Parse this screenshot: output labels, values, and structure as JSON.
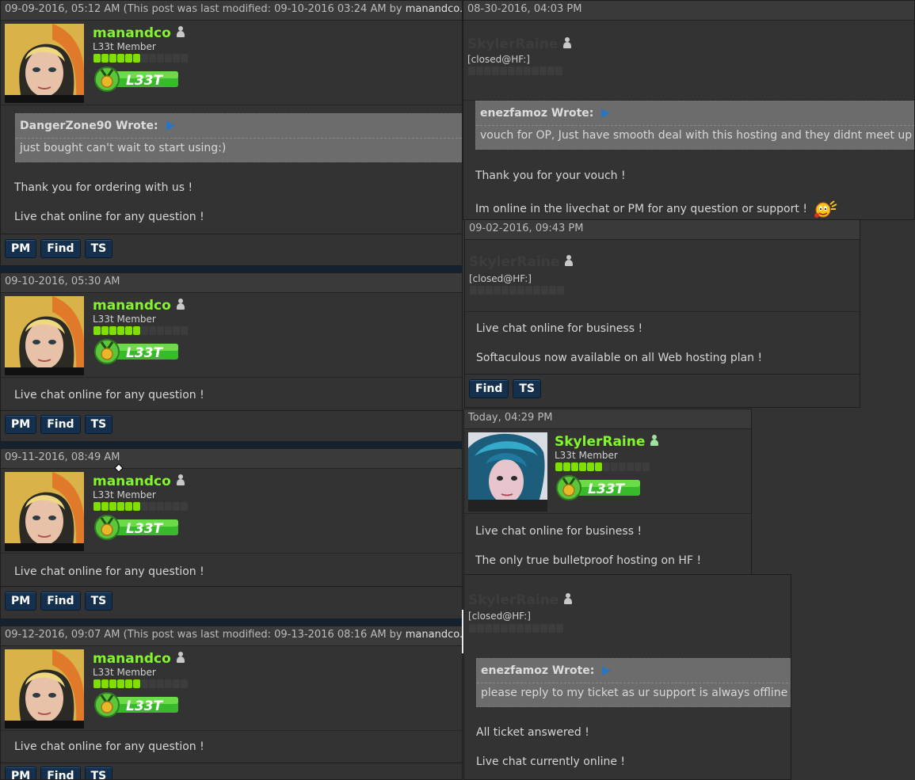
{
  "colors": {
    "username": "#83f52c",
    "ghost_username": "#3d3d3d",
    "button_bg": "#15304d",
    "quote_bg": "#6c6c6c",
    "reputation": "#7fe000"
  },
  "user": {
    "name": "manandco",
    "title": "L33t Member",
    "badge": "L33T"
  },
  "skyler": {
    "name": "SkylerRaine",
    "title": "L33t Member",
    "closed_title": "[closed@HF:]",
    "badge": "L33T"
  },
  "buttons": {
    "pm": "PM",
    "find": "Find",
    "ts": "TS"
  },
  "left_posts": [
    {
      "date": "09-09-2016, 05:12 AM",
      "modified_prefix": "(This post was last modified: 09-10-2016 03:24 AM by ",
      "modified_by": "manandco.",
      "quote_author": "DangerZone90 Wrote:",
      "quote_text": "just bought can't wait to start using:)",
      "line1": "Thank you for ordering with us !",
      "line2": "Live chat online for any question !"
    },
    {
      "date": "09-10-2016, 05:30 AM",
      "line1": "Live chat online for any question !"
    },
    {
      "date": "09-11-2016, 08:49 AM",
      "line1": "Live chat online for any question !"
    },
    {
      "date": "09-12-2016, 09:07 AM",
      "modified_prefix": "(This post was last modified: 09-13-2016 08:16 AM by ",
      "modified_by": "manandco.",
      "line1": "Live chat online for any question !"
    }
  ],
  "right_posts": [
    {
      "date": "08-30-2016, 04:03 PM",
      "quote_author": "enezfamoz Wrote:",
      "quote_text": "vouch for OP, Just have smooth deal with this hosting and they didnt meet up",
      "line1": "Thank you for your vouch !",
      "line2": "Im online in the livechat or PM for any question or support !"
    },
    {
      "date": "09-02-2016, 09:43 PM",
      "line1": "Live chat online for business !",
      "line2": "Softaculous now available on all Web hosting plan !"
    },
    {
      "date": "Today, 04:29 PM",
      "line1": "Live chat online for business !",
      "line2": "The only true bulletproof hosting on HF !"
    },
    {
      "quote_author": "enezfamoz Wrote:",
      "quote_text": "please reply to my ticket as ur support is always offline",
      "line1": "All ticket answered !",
      "line2": "Live chat currently online !"
    }
  ]
}
